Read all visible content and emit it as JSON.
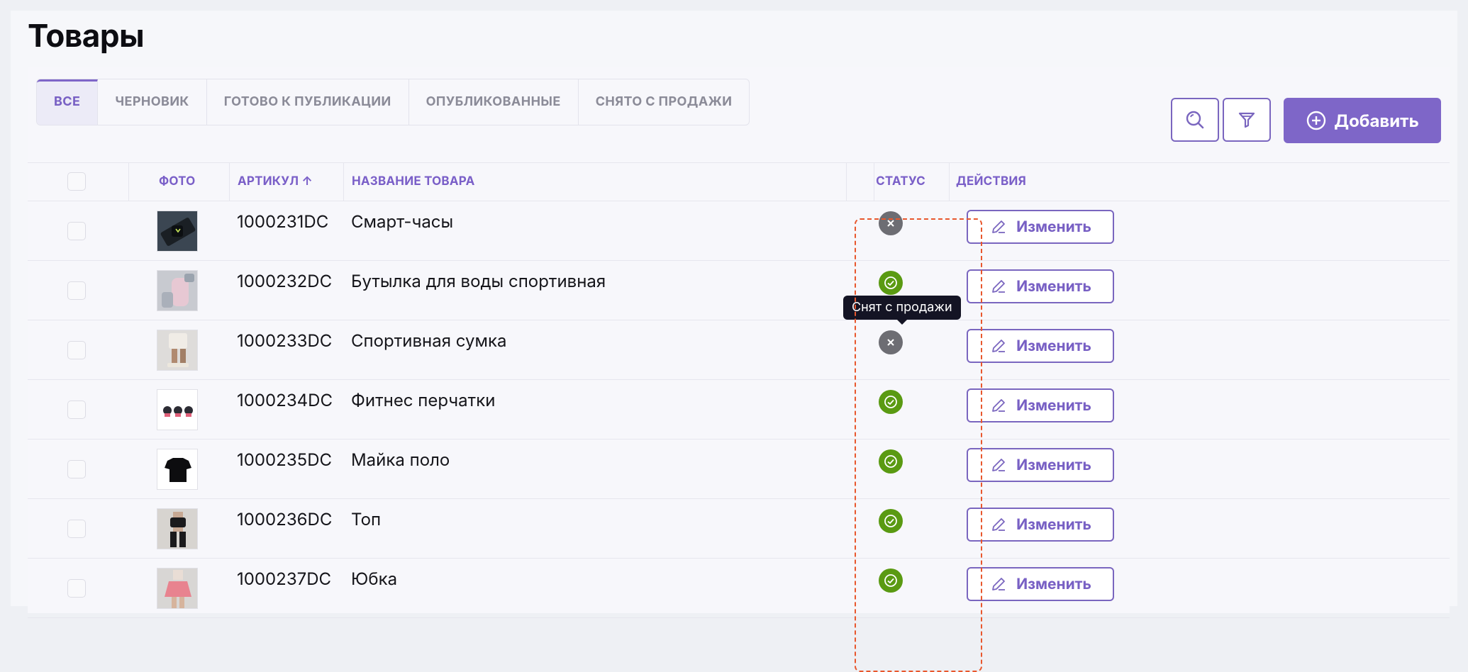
{
  "page_title": "Товары",
  "tabs": [
    {
      "label": "ВСЕ",
      "active": true
    },
    {
      "label": "ЧЕРНОВИК",
      "active": false
    },
    {
      "label": "ГОТОВО К ПУБЛИКАЦИИ",
      "active": false
    },
    {
      "label": "ОПУБЛИКОВАННЫЕ",
      "active": false
    },
    {
      "label": "СНЯТО С ПРОДАЖИ",
      "active": false
    }
  ],
  "toolbar": {
    "search_icon": "search-icon",
    "filter_icon": "filter-icon",
    "add_label": "Добавить"
  },
  "table": {
    "headers": {
      "photo": "ФОТО",
      "sku": "АРТИКУЛ ↑",
      "name": "НАЗВАНИЕ ТОВАРА",
      "status": "СТАТУС",
      "actions": "ДЕЙСТВИЯ"
    },
    "edit_label": "Изменить",
    "rows": [
      {
        "sku": "1000231DC",
        "name": "Смарт-часы",
        "status": "off"
      },
      {
        "sku": "1000232DC",
        "name": "Бутылка для воды спортивная",
        "status": "on"
      },
      {
        "sku": "1000233DC",
        "name": "Спортивная сумка",
        "status": "off"
      },
      {
        "sku": "1000234DC",
        "name": "Фитнес перчатки",
        "status": "on"
      },
      {
        "sku": "1000235DC",
        "name": "Майка поло",
        "status": "on"
      },
      {
        "sku": "1000236DC",
        "name": "Топ",
        "status": "on"
      },
      {
        "sku": "1000237DC",
        "name": "Юбка",
        "status": "on"
      }
    ]
  },
  "tooltip": "Снят с продажи",
  "colors": {
    "accent": "#7e66c8",
    "status_on": "#5a9a12",
    "status_off": "#6d6d73",
    "highlight": "#e8572d"
  }
}
